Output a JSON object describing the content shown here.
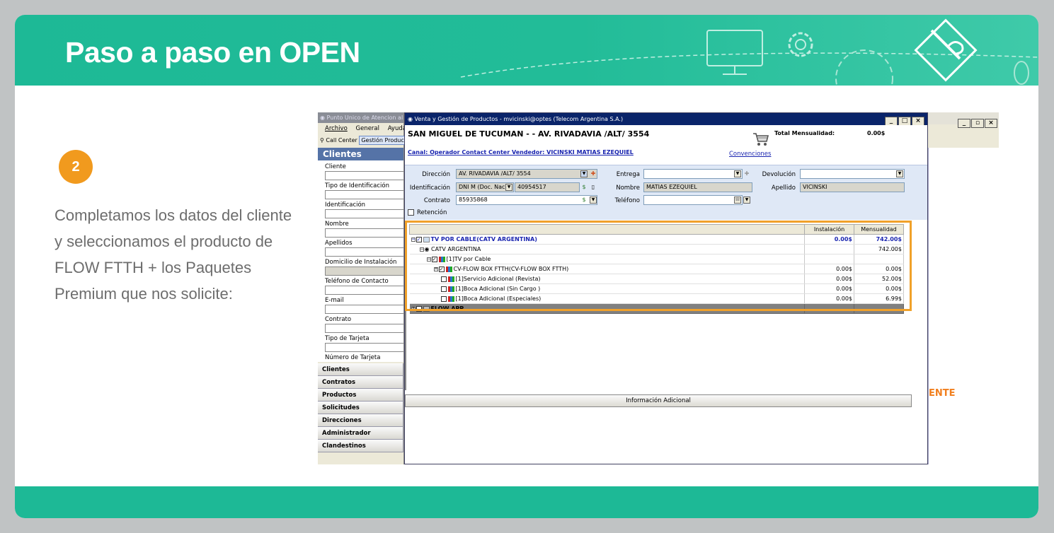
{
  "slide": {
    "title": "Paso a paso en OPEN",
    "step_number": "2",
    "description": "Completamos los datos del cliente y seleccionamos el producto de FLOW FTTH + los Paquetes Premium que nos solicite:"
  },
  "back_window": {
    "title": "Punto Unico de Atencion al",
    "menu": [
      "Archivo",
      "General",
      "Ayuda"
    ],
    "toolbar": [
      "Call Center",
      "Gestión Produc"
    ],
    "section_title": "Clientes",
    "fields": [
      "Cliente",
      "Tipo de Identificación",
      "Identificación",
      "Nombre",
      "Apellidos",
      "Domicilio de Instalación",
      "Teléfono de Contacto",
      "E-mail",
      "Contrato",
      "Tipo de Tarjeta",
      "Número de Tarjeta"
    ],
    "nav": [
      "Clientes",
      "Contratos",
      "Productos",
      "Solicitudes",
      "Direcciones",
      "Administrador",
      "Clandestinos"
    ],
    "right_partial_text": "ENTE"
  },
  "main_window": {
    "title": "Venta y Gestión de Productos - mvicinski@optes (Telecom Argentina S.A.)",
    "address_header": "SAN MIGUEL DE TUCUMAN -  - AV. RIVADAVIA /ALT/ 3554",
    "canal": "Canal: Operador Contact Center Vendedor: VICINSKI MATIAS EZEQUIEL",
    "convenciones": "Convenciones",
    "total_label": "Total Mensualidad:",
    "total_value": "0.00$",
    "form": {
      "direccion_label": "Dirección",
      "direccion_value": "AV. RIVADAVIA /ALT/ 3554",
      "identificacion_label": "Identificación",
      "id_type": "DNI M (Doc. Nac",
      "id_number": "40954517",
      "contrato_label": "Contrato",
      "contrato_value": "85935868",
      "retencion_label": "Retención",
      "entrega_label": "Entrega",
      "nombre_label": "Nombre",
      "nombre_value": "MATIAS EZEQUIEL",
      "telefono_label": "Teléfono",
      "devolucion_label": "Devolución",
      "apellido_label": "Apellido",
      "apellido_value": "VICINSKI"
    },
    "table": {
      "headers": [
        "",
        "Instalación",
        "Mensualidad"
      ],
      "rows": [
        {
          "name": "TV POR CABLE(CATV ARGENTINA)",
          "inst": "0.00$",
          "mens": "742.00$"
        },
        {
          "name": "CATV ARGENTINA",
          "inst": "",
          "mens": "742.00$"
        },
        {
          "name": "[1]TV por Cable",
          "inst": "",
          "mens": ""
        },
        {
          "name": "CV-FLOW BOX FTTH(CV-FLOW BOX FTTH)",
          "inst": "0.00$",
          "mens": "0.00$"
        },
        {
          "name": "[1]Servicio Adicional (Revista)",
          "inst": "0.00$",
          "mens": "52.00$"
        },
        {
          "name": "[1]Boca Adicional (Sin Cargo )",
          "inst": "0.00$",
          "mens": "0.00$"
        },
        {
          "name": "[1]Boca Adicional (Especiales)",
          "inst": "0.00$",
          "mens": "6.99$"
        },
        {
          "name": "FLOW APP",
          "inst": "",
          "mens": ""
        }
      ]
    },
    "info_button": "Información Adicional"
  },
  "colors": {
    "header_green": "#1db996",
    "step_orange": "#f19a1e",
    "highlight_orange": "#f0a12a",
    "link_blue": "#1a25b0"
  }
}
